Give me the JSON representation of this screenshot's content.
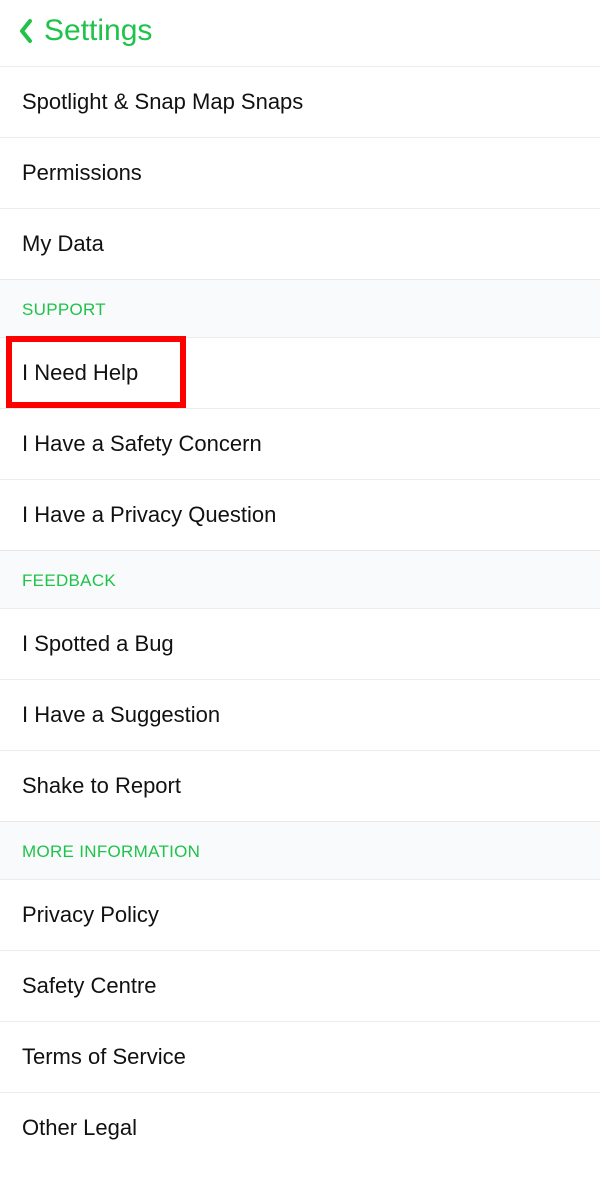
{
  "header": {
    "title": "Settings"
  },
  "top_items": [
    {
      "label": "Spotlight & Snap Map Snaps"
    },
    {
      "label": "Permissions"
    },
    {
      "label": "My Data"
    }
  ],
  "sections": [
    {
      "title": "SUPPORT",
      "items": [
        {
          "label": "I Need Help",
          "highlight": true
        },
        {
          "label": "I Have a Safety Concern"
        },
        {
          "label": "I Have a Privacy Question"
        }
      ]
    },
    {
      "title": "FEEDBACK",
      "items": [
        {
          "label": "I Spotted a Bug"
        },
        {
          "label": "I Have a Suggestion"
        },
        {
          "label": "Shake to Report"
        }
      ]
    },
    {
      "title": "MORE INFORMATION",
      "items": [
        {
          "label": "Privacy Policy"
        },
        {
          "label": "Safety Centre"
        },
        {
          "label": "Terms of Service"
        },
        {
          "label": "Other Legal"
        }
      ]
    }
  ]
}
